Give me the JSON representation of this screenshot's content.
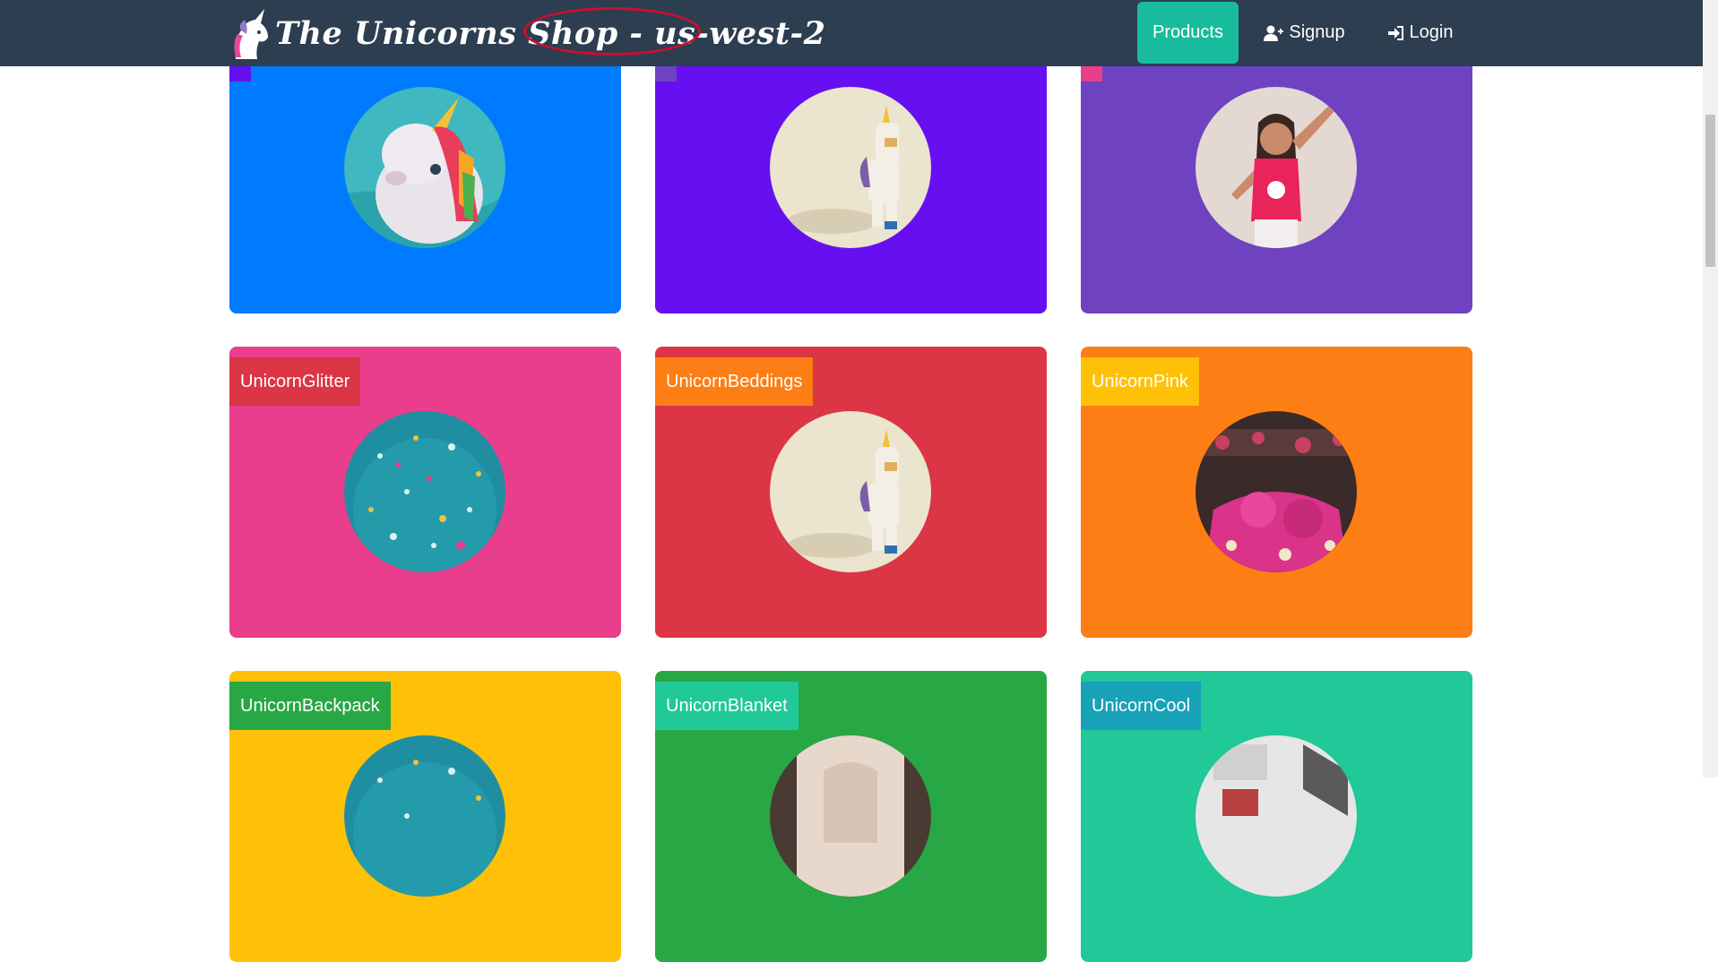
{
  "navbar": {
    "brand_title": "The Unicorns Shop - ",
    "region": "us-west-2",
    "products_label": "Products",
    "signup_label": "Signup",
    "login_label": "Login"
  },
  "products": [
    {
      "label": "",
      "color": "#007bff",
      "badge_color": "#6610f2",
      "image": "inflatable-unicorn"
    },
    {
      "label": "",
      "color": "#6610f2",
      "badge_color": "#6f42c1",
      "image": "toy-unicorn"
    },
    {
      "label": "",
      "color": "#6f42c1",
      "badge_color": "#e83e8c",
      "image": "girl-unicorn-shirt"
    },
    {
      "label": "UnicornGlitter",
      "color": "#e83e8c",
      "badge_color": "#dc3545",
      "image": "glitter"
    },
    {
      "label": "UnicornBeddings",
      "color": "#dc3545",
      "badge_color": "#fd7e14",
      "image": "toy-unicorn"
    },
    {
      "label": "UnicornPink",
      "color": "#fd7e14",
      "badge_color": "#ffc107",
      "image": "pink-plush-market"
    },
    {
      "label": "UnicornBackpack",
      "color": "#ffc107",
      "badge_color": "#28a745",
      "image": "glitter"
    },
    {
      "label": "UnicornBlanket",
      "color": "#28a745",
      "badge_color": "#20c997",
      "image": "blanket"
    },
    {
      "label": "UnicornCool",
      "color": "#20c997",
      "badge_color": "#17a2b8",
      "image": "cool"
    }
  ]
}
